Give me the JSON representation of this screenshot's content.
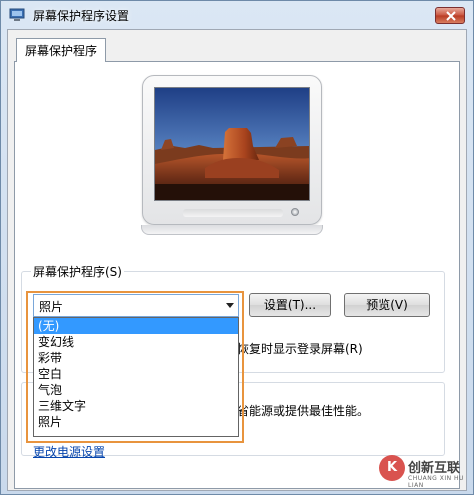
{
  "window": {
    "title": "屏幕保护程序设置",
    "close_label": "✕"
  },
  "tabs": [
    {
      "label": "屏幕保护程序",
      "active": true
    }
  ],
  "preview": {
    "image_icon": "desert-landscape-image"
  },
  "screensaver_group": {
    "label": "屏幕保护程序(S)",
    "selected_value": "照片",
    "settings_button": "设置(T)...",
    "preview_button": "预览(V)",
    "resume_text": "恢复时显示登录屏幕(R)",
    "options": [
      "(无)",
      "变幻线",
      "彩带",
      "空白",
      "气泡",
      "三维文字",
      "照片"
    ],
    "highlighted_option": "(无)"
  },
  "power_group": {
    "text": "省能源或提供最佳性能。",
    "link": "更改电源设置"
  },
  "watermark": {
    "mark": "K",
    "name": "创新互联",
    "sub": "CHUANG XIN HU LIAN"
  },
  "colors": {
    "selection": "#3399ff",
    "highlight_border": "#e8943e",
    "link": "#0645ad"
  }
}
